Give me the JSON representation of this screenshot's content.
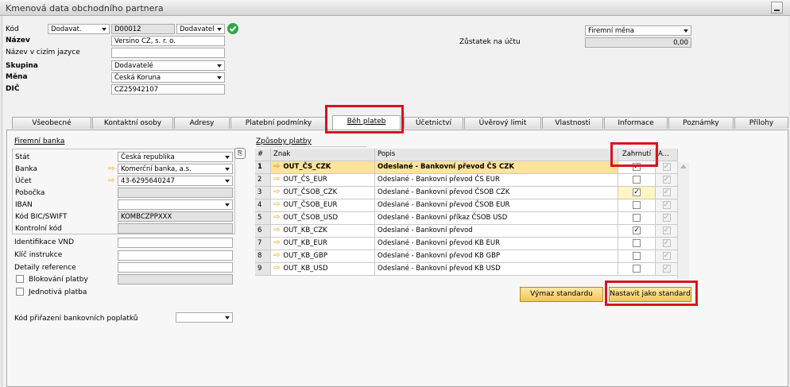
{
  "window": {
    "title": "Kmenová data obchodního partnera"
  },
  "header": {
    "kod_label": "Kód",
    "kod_type": "Dodavat.",
    "kod_value": "D00012",
    "kod_role": "Dodavatel",
    "nazev_label": "Název",
    "nazev_value": "Versino CZ, s. r. o.",
    "nazev_ciz_label": "Název v cizím jazyce",
    "nazev_ciz_value": "",
    "skupina_label": "Skupina",
    "skupina_value": "Dodavatelé",
    "mena_label": "Měna",
    "mena_value": "Česká Koruna",
    "dic_label": "DIČ",
    "dic_value": "CZ25942107",
    "currency_select": "Firemní měna",
    "zustatek_label": "Zůstatek na účtu",
    "zustatek_value": "0,00"
  },
  "tabs": [
    "Všeobecné",
    "Kontaktní osoby",
    "Adresy",
    "Platební podmínky",
    "Běh plateb",
    "Účetnictví",
    "Úvěrový limit",
    "Vlastnosti",
    "Informace",
    "Poznámky",
    "Přílohy"
  ],
  "active_tab": "Běh plateb",
  "bank": {
    "section_title": "Firemní banka",
    "stat_label": "Stát",
    "stat_value": "Česká republika",
    "banka_label": "Banka",
    "banka_value": "Komerční banka, a.s.",
    "ucet_label": "Účet",
    "ucet_value": "43-6295640247",
    "pobocka_label": "Pobočka",
    "pobocka_value": "",
    "iban_label": "IBAN",
    "iban_value": "",
    "bic_label": "Kód BIC/SWIFT",
    "bic_value": "KOMBCZPPXXX",
    "kontrolni_label": "Kontrolní kód",
    "kontrolni_value": "",
    "vnd_label": "Identifikace VND",
    "klic_label": "Klíč instrukce",
    "detaily_label": "Detaily reference",
    "blokovani_label": "Blokování platby",
    "jednotliva_label": "Jednotivá platba",
    "poplatky_label": "Kód přiřazení bankovních poplatků"
  },
  "payments": {
    "section_title": "Způsoby platby",
    "columns": [
      "#",
      "Znak",
      "Popis",
      "Zahrnutí",
      "A..."
    ],
    "rows": [
      {
        "n": "1",
        "znak": "OUT_ČS_CZK",
        "popis": "Odeslané - Bankovní převod ČS CZK",
        "zahrnuti": true
      },
      {
        "n": "2",
        "znak": "OUT_ČS_EUR",
        "popis": "Odeslané - Bankovní převod ČS EUR",
        "zahrnuti": false
      },
      {
        "n": "3",
        "znak": "OUT_ČSOB_CZK",
        "popis": "Odeslané - Bankovní převod ČSOB CZK",
        "zahrnuti": true
      },
      {
        "n": "4",
        "znak": "OUT_ČSOB_EUR",
        "popis": "Odeslané - Bankovní převod ČSOB EUR",
        "zahrnuti": false
      },
      {
        "n": "5",
        "znak": "OUT_ČSOB_USD",
        "popis": "Odeslané - Bankovní příkaz ČSOB USD",
        "zahrnuti": false
      },
      {
        "n": "6",
        "znak": "OUT_KB_CZK",
        "popis": "Odeslané - Bankovní převod",
        "zahrnuti": true
      },
      {
        "n": "7",
        "znak": "OUT_KB_EUR",
        "popis": "Odeslané - Bankovní převod KB EUR",
        "zahrnuti": false
      },
      {
        "n": "8",
        "znak": "OUT_KB_GBP",
        "popis": "Odeslané - Bankovní převod KB GBP",
        "zahrnuti": false
      },
      {
        "n": "9",
        "znak": "OUT_KB_USD",
        "popis": "Odeslané - Bankovní převod KB USD",
        "zahrnuti": false
      }
    ],
    "vymaz_label": "Výmaz standardu",
    "nastavit_label": "Nastavit jako standard"
  },
  "colors": {
    "highlight_red": "#d8141c",
    "selected_row": "#ffe39b",
    "button_yellow": "#f3c55a",
    "ok_green": "#2ea84a"
  }
}
